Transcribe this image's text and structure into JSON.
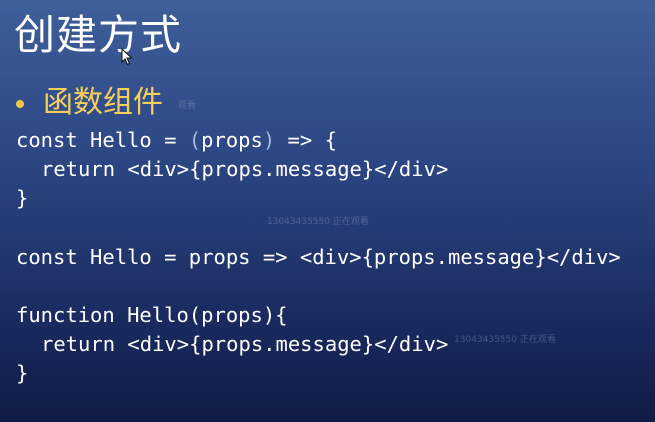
{
  "title": "创建方式",
  "bullet": "函数组件",
  "code_block_1": {
    "line1_a": "const Hello = ",
    "line1_paren_open": "(",
    "line1_param": "props",
    "line1_paren_close": ")",
    "line1_b": " => {",
    "line2": "return <div>{props.message}</div>",
    "line3": "}"
  },
  "code_block_2": {
    "line1": "const Hello = props => <div>{props.message}</div>"
  },
  "code_block_3": {
    "line1": "function Hello(props){",
    "line2": "return <div>{props.message}</div>",
    "line3": "}"
  },
  "watermarks": [
    "观看",
    "13043435550 正在观看",
    "13043435550 正在观看"
  ],
  "colors": {
    "background_top": "#3e5f9a",
    "background_bottom": "#101b46",
    "title_text": "#ffffff",
    "bullet_text": "#f6cf5c",
    "code_text": "#ffffff"
  },
  "icons": {
    "cursor": "mouse-pointer-icon",
    "bullet": "bullet-dot-icon"
  }
}
